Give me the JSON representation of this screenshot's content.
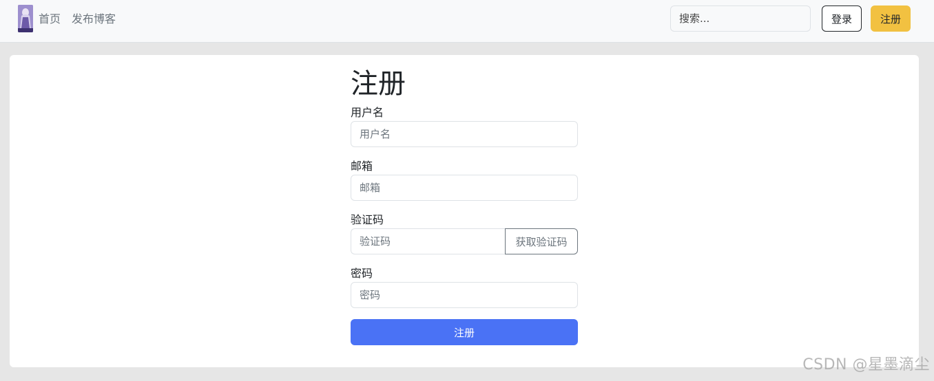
{
  "navbar": {
    "logo_icon": "avatar-logo-icon",
    "links": [
      {
        "label": "首页"
      },
      {
        "label": "发布博客"
      }
    ],
    "search": {
      "placeholder": "搜索...",
      "value": ""
    },
    "login_label": "登录",
    "register_label": "注册"
  },
  "form": {
    "title": "注册",
    "username": {
      "label": "用户名",
      "placeholder": "用户名",
      "value": ""
    },
    "email": {
      "label": "邮箱",
      "placeholder": "邮箱",
      "value": ""
    },
    "code": {
      "label": "验证码",
      "placeholder": "验证码",
      "value": "",
      "button_label": "获取验证码"
    },
    "password": {
      "label": "密码",
      "placeholder": "密码",
      "value": ""
    },
    "submit_label": "注册"
  },
  "watermark": "CSDN @星墨滴尘",
  "colors": {
    "primary": "#4a72f5",
    "warning": "#f2c141",
    "navbar_bg": "#f8f9fa",
    "page_bg": "#e6e6e6"
  }
}
